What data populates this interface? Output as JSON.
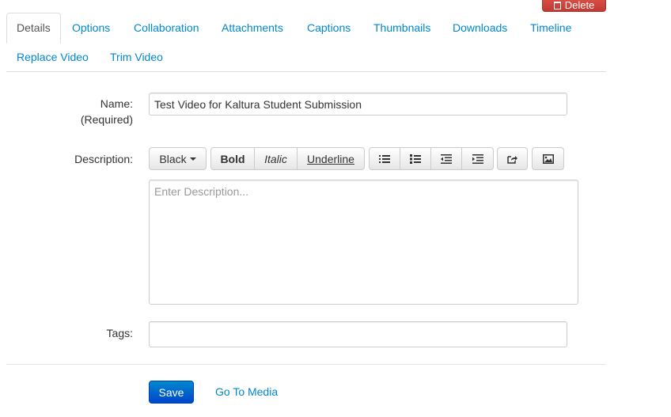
{
  "header": {
    "delete_label": "Delete"
  },
  "tabs": [
    {
      "label": "Details"
    },
    {
      "label": "Options"
    },
    {
      "label": "Collaboration"
    },
    {
      "label": "Attachments"
    },
    {
      "label": "Captions"
    },
    {
      "label": "Thumbnails"
    },
    {
      "label": "Downloads"
    },
    {
      "label": "Timeline"
    },
    {
      "label": "Replace Video"
    },
    {
      "label": "Trim Video"
    }
  ],
  "form": {
    "name_label": "Name:",
    "name_required": "(Required)",
    "name_value": "Test Video for Kaltura Student Submission",
    "description_label": "Description:",
    "description_placeholder": "Enter Description...",
    "tags_label": "Tags:",
    "tags_value": ""
  },
  "toolbar": {
    "color_label": "Black",
    "bold_label": "Bold",
    "italic_label": "Italic",
    "underline_label": "Underline",
    "icons": [
      "unordered-list-icon",
      "ordered-list-icon",
      "outdent-icon",
      "indent-icon",
      "link-icon",
      "image-icon"
    ]
  },
  "actions": {
    "save_label": "Save",
    "goto_label": "Go To Media"
  },
  "colors": {
    "link": "#0088cc",
    "primary": "#0044cc",
    "danger": "#c23a31",
    "border": "#cccccc"
  }
}
